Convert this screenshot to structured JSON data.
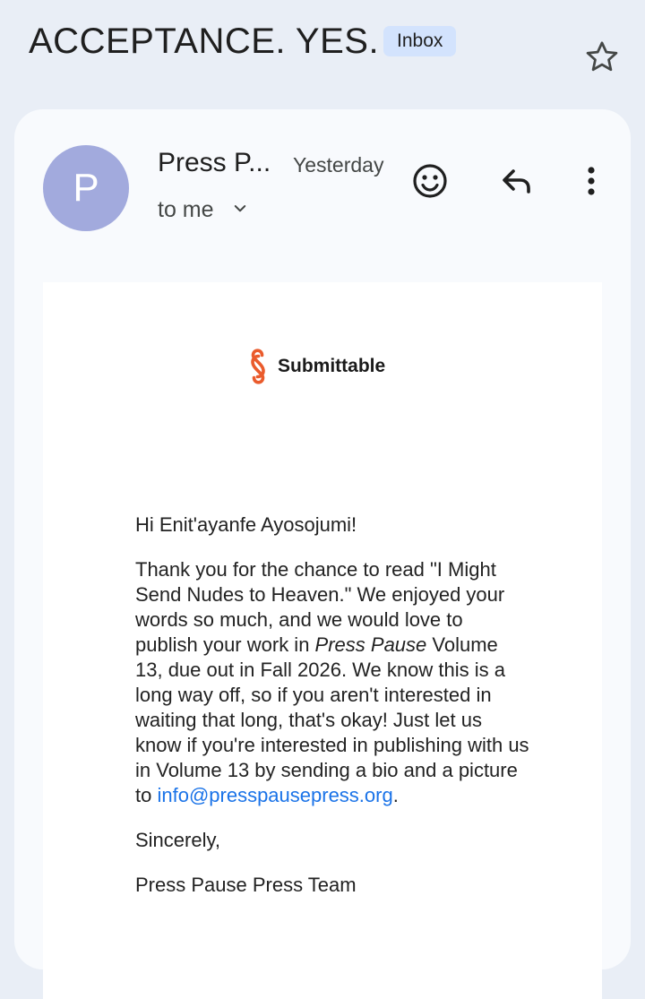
{
  "header": {
    "subject": "ACCEPTANCE. YES.",
    "label": "Inbox",
    "star_icon": "star-icon"
  },
  "email": {
    "avatar_letter": "P",
    "avatar_color": "#a2aadd",
    "sender": "Press P...",
    "date": "Yesterday",
    "recipient": "to me",
    "icons": {
      "recipient_toggle": "chevron-down-icon",
      "emoji": "add-reaction-icon",
      "reply": "reply-icon",
      "more": "more-vertical-icon"
    },
    "brand": {
      "name": "Submittable",
      "color": "#ea5b2c"
    },
    "body": {
      "greeting": "Hi Enit'ayanfe Ayosojumi!",
      "paragraph_part1": "Thank you for the chance to read \"I Might Send Nudes to Heaven.\" We enjoyed your words so much, and we would love to publish your work in ",
      "journal_italic": "Press Pause",
      "paragraph_part2": " Volume 13, due out in Fall 2026. We know this is a long way off, so if you aren't interested in waiting that long, that's okay! Just let us know if you're interested in publishing with us in Volume 13 by sending a bio and a picture to ",
      "email_link": "info@presspausepress.org",
      "paragraph_end": ".",
      "closing": "Sincerely,",
      "signature": "Press Pause Press Team"
    }
  },
  "colors": {
    "background": "#e9eef6",
    "card": "#f8fafd",
    "badge": "#d3e3fd",
    "link": "#1a73e8"
  }
}
